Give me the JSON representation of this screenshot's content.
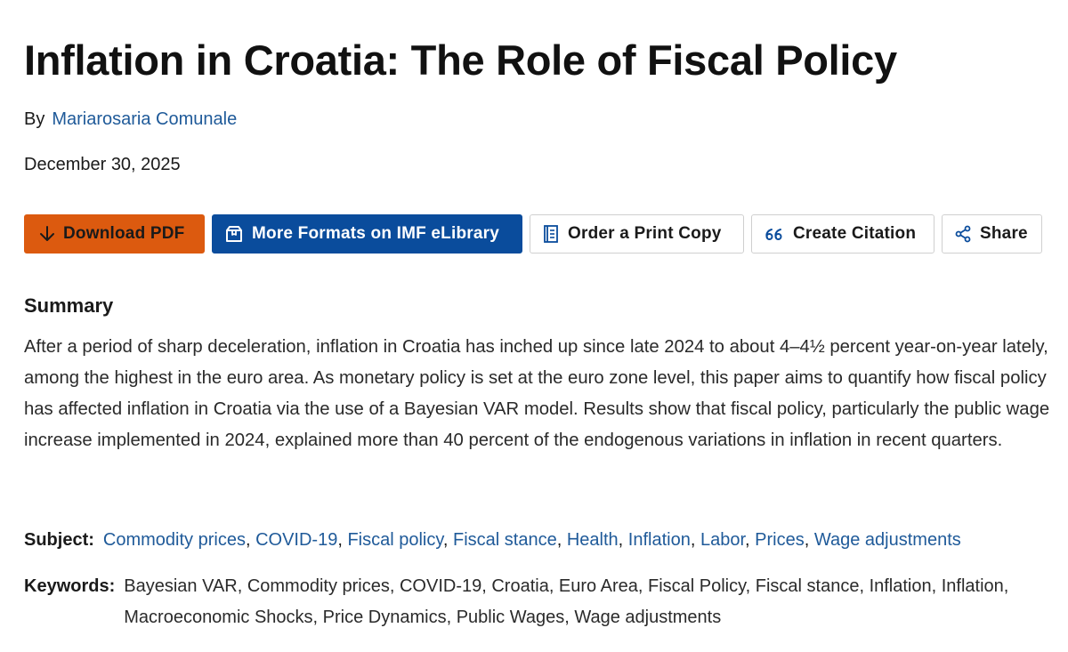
{
  "title": "Inflation in Croatia: The Role of Fiscal Policy",
  "byline": {
    "by_label": "By",
    "author": "Mariarosaria Comunale"
  },
  "date": "December 30, 2025",
  "actions": {
    "download": {
      "label": "Download PDF",
      "icon": "arrow-down-icon"
    },
    "formats": {
      "label": "More Formats on IMF eLibrary",
      "icon": "box-icon"
    },
    "print": {
      "label": "Order a Print Copy",
      "icon": "book-icon"
    },
    "citation": {
      "label": "Create Citation",
      "icon": "quote-icon"
    },
    "share": {
      "label": "Share",
      "icon": "share-icon"
    }
  },
  "summary": {
    "heading": "Summary",
    "text": "After a period of sharp deceleration, inflation in Croatia has inched up since late 2024 to about 4–4½ percent year-on-year lately, among the highest in the euro area. As monetary policy is set at the euro zone level, this paper aims to quantify how fiscal policy has affected inflation in Croatia via the use of a Bayesian VAR model. Results show that fiscal policy, particularly the public wage increase implemented in 2024, explained more than 40 percent of the endogenous variations in inflation in recent quarters."
  },
  "subject": {
    "label": "Subject:",
    "items": [
      "Commodity prices",
      "COVID-19",
      "Fiscal policy",
      "Fiscal stance",
      "Health",
      "Inflation",
      "Labor",
      "Prices",
      "Wage adjustments"
    ]
  },
  "keywords": {
    "label": "Keywords:",
    "text": "Bayesian VAR, Commodity prices, COVID-19, Croatia, Euro Area, Fiscal Policy, Fiscal stance, Inflation, Inflation, Macroeconomic Shocks, Price Dynamics, Public Wages, Wage adjustments"
  },
  "colors": {
    "download_bg": "#dc5a0f",
    "formats_bg": "#0a4c9c",
    "link": "#1f5a99"
  }
}
